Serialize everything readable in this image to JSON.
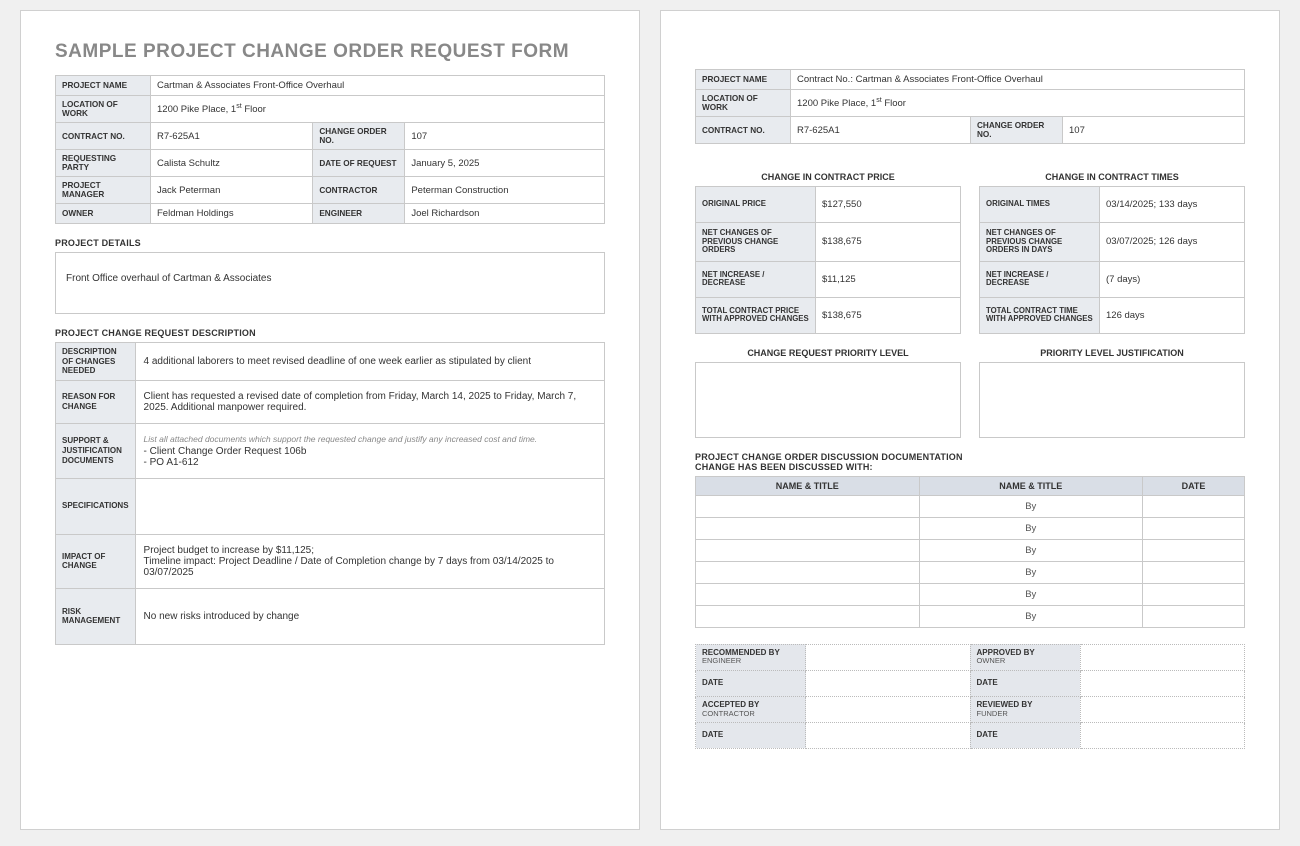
{
  "title": "SAMPLE PROJECT CHANGE ORDER REQUEST FORM",
  "labels": {
    "project_name": "PROJECT NAME",
    "location_of_work": "LOCATION OF WORK",
    "contract_no": "CONTRACT NO.",
    "change_order_no": "CHANGE ORDER NO.",
    "requesting_party": "REQUESTING PARTY",
    "date_of_request": "DATE OF REQUEST",
    "project_manager": "PROJECT MANAGER",
    "contractor": "CONTRACTOR",
    "owner": "OWNER",
    "engineer": "ENGINEER",
    "project_details": "PROJECT DETAILS",
    "project_change_desc": "PROJECT CHANGE REQUEST DESCRIPTION",
    "desc_changes": "DESCRIPTION OF CHANGES NEEDED",
    "reason_for_change": "REASON FOR CHANGE",
    "support_docs": "SUPPORT & JUSTIFICATION DOCUMENTS",
    "support_hint": "List all attached documents which support the requested change and justify any increased cost and time.",
    "specifications": "SPECIFICATIONS",
    "impact_of_change": "IMPACT OF CHANGE",
    "risk_mgmt": "RISK MANAGEMENT",
    "change_in_price": "CHANGE IN CONTRACT PRICE",
    "change_in_times": "CHANGE IN CONTRACT TIMES",
    "original_price": "ORIGINAL PRICE",
    "net_changes_prev": "NET CHANGES OF PREVIOUS CHANGE ORDERS",
    "net_increase": "NET INCREASE / DECREASE",
    "total_price_approved": "TOTAL CONTRACT PRICE WITH APPROVED CHANGES",
    "original_times": "ORIGINAL TIMES",
    "net_changes_prev_days": "NET CHANGES OF PREVIOUS CHANGE ORDERS IN DAYS",
    "total_time_approved": "TOTAL CONTRACT TIME WITH APPROVED CHANGES",
    "priority_level": "CHANGE REQUEST PRIORITY LEVEL",
    "priority_justification": "PRIORITY LEVEL JUSTIFICATION",
    "discussion_doc": "PROJECT CHANGE ORDER DISCUSSION DOCUMENTATION",
    "discussed_with": "CHANGE HAS BEEN DISCUSSED WITH:",
    "name_title": "NAME & TITLE",
    "date": "DATE",
    "recommended_by": "RECOMMENDED BY",
    "engineer_sub": "ENGINEER",
    "approved_by": "APPROVED BY",
    "owner_sub": "OWNER",
    "accepted_by": "ACCEPTED BY",
    "contractor_sub": "CONTRACTOR",
    "reviewed_by": "REVIEWED BY",
    "funder_sub": "FUNDER"
  },
  "page1": {
    "project_name": "Cartman & Associates Front-Office Overhaul",
    "location_of_work_pre": "1200 Pike Place, 1",
    "location_of_work_sup": "st",
    "location_of_work_post": " Floor",
    "contract_no": "R7-625A1",
    "change_order_no": "107",
    "requesting_party": "Calista Schultz",
    "date_of_request": "January 5, 2025",
    "project_manager": "Jack Peterman",
    "contractor": "Peterman Construction",
    "owner": "Feldman Holdings",
    "engineer": "Joel Richardson",
    "project_details": "Front Office overhaul of Cartman & Associates",
    "desc_changes": "4 additional laborers to meet revised deadline of one week earlier as stipulated by client",
    "reason_for_change": "Client has requested a revised date of completion from Friday, March 14, 2025 to Friday, March 7, 2025.  Additional manpower required.",
    "support_docs_l1": "- Client Change Order Request 106b",
    "support_docs_l2": "- PO A1-612",
    "specifications": "",
    "impact_of_change": "Project budget to increase by $11,125;\nTimeline impact: Project Deadline / Date of Completion change by 7 days from 03/14/2025 to 03/07/2025",
    "risk_mgmt": "No new risks introduced by change"
  },
  "page2": {
    "project_name": "Contract No.: Cartman & Associates Front-Office Overhaul",
    "location_of_work_pre": "1200 Pike Place, 1",
    "location_of_work_sup": "st",
    "location_of_work_post": " Floor",
    "contract_no": "R7-625A1",
    "change_order_no": "107",
    "price": {
      "original": "$127,550",
      "net_prev": "$138,675",
      "net_increase": "$11,125",
      "total_approved": "$138,675"
    },
    "times": {
      "original": "03/14/2025; 133 days",
      "net_prev": "03/07/2025; 126 days",
      "net_increase": "(7 days)",
      "total_approved": "126 days"
    }
  }
}
